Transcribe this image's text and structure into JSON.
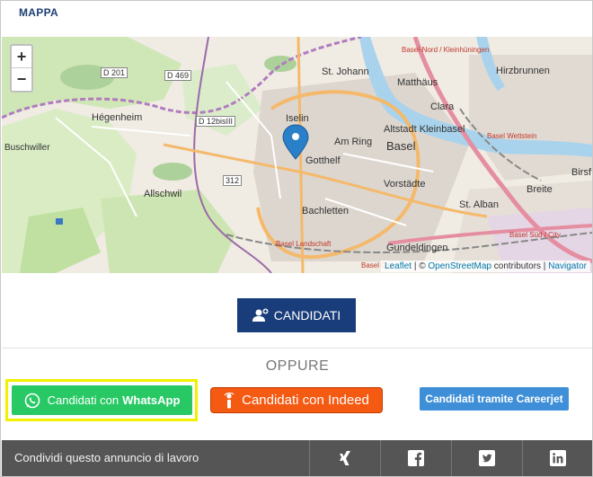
{
  "section": {
    "title": "MAPPA"
  },
  "map": {
    "zoom_in": "+",
    "zoom_out": "−",
    "labels": {
      "d201": "D 201",
      "d469": "D 469",
      "d12": "D 12bisIII",
      "r312": "312",
      "hegenheim": "Hégenheim",
      "buschwiller": "Buschwiller",
      "allschwil": "Allschwil",
      "st_johann": "St. Johann",
      "matthaus": "Matthäus",
      "clara": "Clara",
      "iselin": "Iselin",
      "am_ring": "Am Ring",
      "basel": "Basel",
      "altstadt": "Altstadt Kleinbasel",
      "gotthelf": "Gotthelf",
      "vorstadte": "Vorstädte",
      "bachletten": "Bachletten",
      "st_alban": "St. Alban",
      "gundeldingen": "Gundeldingen",
      "hirzbrunnen": "Hirzbrunnen",
      "breite": "Breite",
      "birsf": "Birsf",
      "basel_nord": "Basel-Nord / Kleinhüningen",
      "basel_wettstein": "Basel Wettstein",
      "basel_sud": "Basel Süd / City",
      "basel_landschaft": "Basel Landschaft",
      "basel_city": "Basel City"
    },
    "attribution": {
      "leaflet": "Leaflet",
      "sep1": " | © ",
      "osm": "OpenStreetMap",
      "contrib": " contributors | ",
      "navigator": "Navigator"
    }
  },
  "apply": {
    "label": "CANDIDATI"
  },
  "oppure": "OPPURE",
  "whatsapp": {
    "label_prefix": "Candidati con",
    "label_brand": "WhatsApp"
  },
  "indeed": {
    "label": "Candidati con Indeed"
  },
  "careerjet": {
    "label": "Candidati tramite Careerjet"
  },
  "footer": {
    "share_text": "Condividi questo annuncio di lavoro",
    "icons": [
      "xing-icon",
      "facebook-icon",
      "twitter-icon",
      "linkedin-icon"
    ]
  },
  "colors": {
    "brand_blue": "#183d7a",
    "whatsapp_green": "#28c965",
    "indeed_orange": "#f55a13",
    "careerjet_blue": "#3f8fd8",
    "highlight_yellow": "#f2f000",
    "footer_gray": "#555555"
  }
}
